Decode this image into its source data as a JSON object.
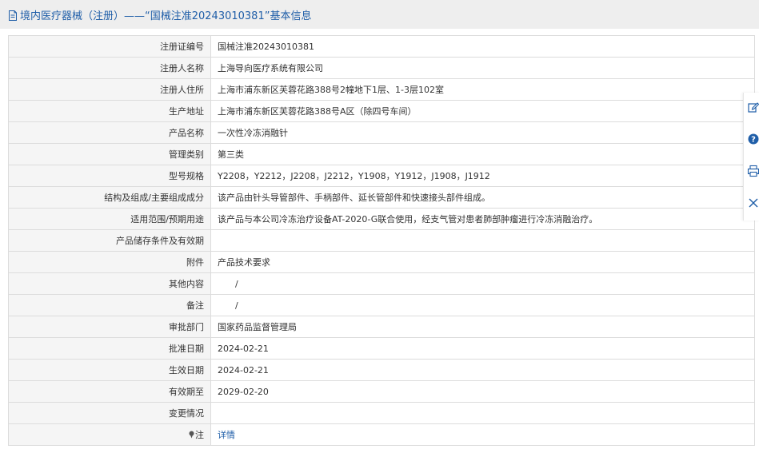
{
  "header": {
    "title": "境内医疗器械（注册）——“国械注准20243010381”基本信息"
  },
  "rows": [
    {
      "label": "注册证编号",
      "value": "国械注准20243010381"
    },
    {
      "label": "注册人名称",
      "value": "上海导向医疗系统有限公司"
    },
    {
      "label": "注册人住所",
      "value": "上海市浦东新区芙蓉花路388号2幢地下1层、1-3层102室"
    },
    {
      "label": "生产地址",
      "value": "上海市浦东新区芙蓉花路388号A区（除四号车间）"
    },
    {
      "label": "产品名称",
      "value": "一次性冷冻消融针"
    },
    {
      "label": "管理类别",
      "value": "第三类"
    },
    {
      "label": "型号规格",
      "value": "Y2208，Y2212，J2208，J2212，Y1908，Y1912，J1908，J1912"
    },
    {
      "label": "结构及组成/主要组成成分",
      "value": "该产品由针头导管部件、手柄部件、延长管部件和快速接头部件组成。"
    },
    {
      "label": "适用范围/预期用途",
      "value": "该产品与本公司冷冻治疗设备AT-2020-G联合使用，经支气管对患者肺部肿瘤进行冷冻消融治疗。"
    },
    {
      "label": "产品储存条件及有效期",
      "value": ""
    },
    {
      "label": "附件",
      "value": "产品技术要求"
    },
    {
      "label": "其他内容",
      "value": "/"
    },
    {
      "label": "备注",
      "value": "/"
    },
    {
      "label": "审批部门",
      "value": "国家药品监督管理局"
    },
    {
      "label": "批准日期",
      "value": "2024-02-21"
    },
    {
      "label": "生效日期",
      "value": "2024-02-21"
    },
    {
      "label": "有效期至",
      "value": "2029-02-20"
    },
    {
      "label": "变更情况",
      "value": ""
    }
  ],
  "note": {
    "label": "注",
    "link": "详情"
  },
  "side_toolbar": {
    "icons": [
      "edit-icon",
      "help-icon",
      "print-icon",
      "close-icon"
    ]
  },
  "colors": {
    "accent": "#1f5ea8",
    "header_bg": "#eeeeee",
    "label_bg": "#f5f5f5",
    "border": "#dcdcdc"
  }
}
